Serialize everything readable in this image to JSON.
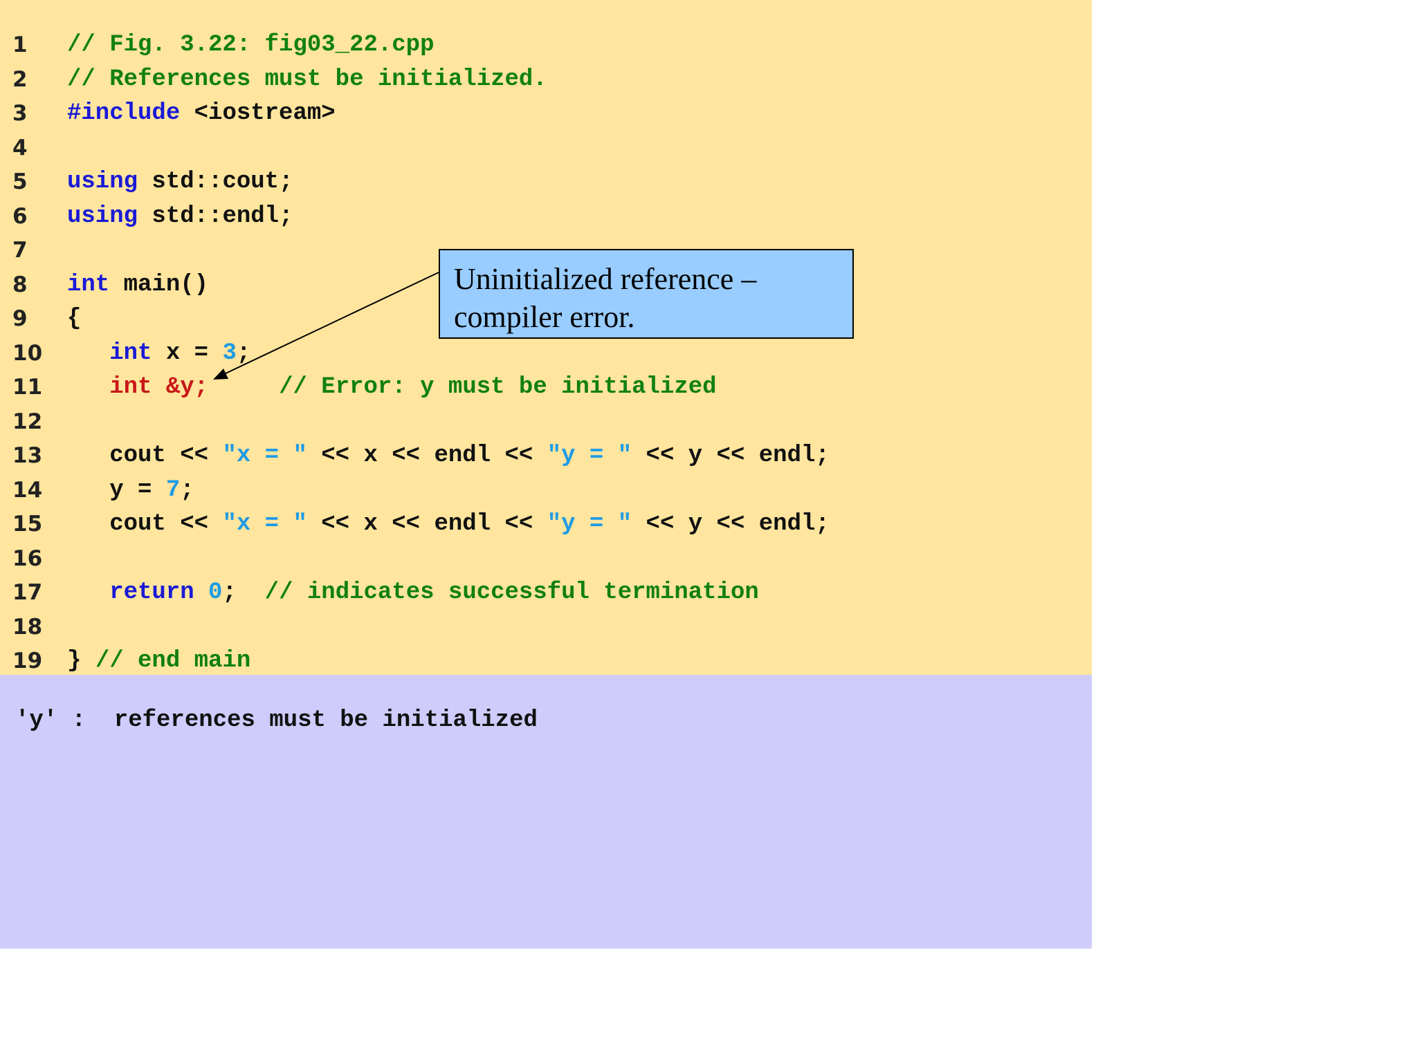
{
  "code": {
    "lines": [
      {
        "num": "1",
        "segments": [
          {
            "t": "// Fig. 3.22: fig03_22.cpp",
            "c": "cm"
          }
        ]
      },
      {
        "num": "2",
        "segments": [
          {
            "t": "// References must be initialized.",
            "c": "cm"
          }
        ]
      },
      {
        "num": "3",
        "segments": [
          {
            "t": "#include",
            "c": "kw"
          },
          {
            "t": " <iostream>",
            "c": ""
          }
        ]
      },
      {
        "num": "4",
        "segments": []
      },
      {
        "num": "5",
        "segments": [
          {
            "t": "using",
            "c": "kw"
          },
          {
            "t": " std::cout;",
            "c": ""
          }
        ]
      },
      {
        "num": "6",
        "segments": [
          {
            "t": "using",
            "c": "kw"
          },
          {
            "t": " std::endl;",
            "c": ""
          }
        ]
      },
      {
        "num": "7",
        "segments": []
      },
      {
        "num": "8",
        "segments": [
          {
            "t": "int",
            "c": "kw"
          },
          {
            "t": " main()",
            "c": ""
          }
        ]
      },
      {
        "num": "9",
        "segments": [
          {
            "t": "{",
            "c": ""
          }
        ]
      },
      {
        "num": "10",
        "segments": [
          {
            "t": "   ",
            "c": ""
          },
          {
            "t": "int",
            "c": "kw"
          },
          {
            "t": " x = ",
            "c": ""
          },
          {
            "t": "3",
            "c": "num"
          },
          {
            "t": ";",
            "c": ""
          }
        ]
      },
      {
        "num": "11",
        "segments": [
          {
            "t": "   ",
            "c": ""
          },
          {
            "t": "int &y;",
            "c": "err"
          },
          {
            "t": "     ",
            "c": ""
          },
          {
            "t": "// Error: y must be initialized",
            "c": "cm"
          }
        ]
      },
      {
        "num": "12",
        "segments": []
      },
      {
        "num": "13",
        "segments": [
          {
            "t": "   cout << ",
            "c": ""
          },
          {
            "t": "\"x = \"",
            "c": "str"
          },
          {
            "t": " << x << endl << ",
            "c": ""
          },
          {
            "t": "\"y = \"",
            "c": "str"
          },
          {
            "t": " << y << endl;",
            "c": ""
          }
        ]
      },
      {
        "num": "14",
        "segments": [
          {
            "t": "   y = ",
            "c": ""
          },
          {
            "t": "7",
            "c": "num"
          },
          {
            "t": ";",
            "c": ""
          }
        ]
      },
      {
        "num": "15",
        "segments": [
          {
            "t": "   cout << ",
            "c": ""
          },
          {
            "t": "\"x = \"",
            "c": "str"
          },
          {
            "t": " << x << endl << ",
            "c": ""
          },
          {
            "t": "\"y = \"",
            "c": "str"
          },
          {
            "t": " << y << endl;",
            "c": ""
          }
        ]
      },
      {
        "num": "16",
        "segments": []
      },
      {
        "num": "17",
        "segments": [
          {
            "t": "   ",
            "c": ""
          },
          {
            "t": "return",
            "c": "kw"
          },
          {
            "t": " ",
            "c": ""
          },
          {
            "t": "0",
            "c": "num"
          },
          {
            "t": ";  ",
            "c": ""
          },
          {
            "t": "// indicates successful termination",
            "c": "cm"
          }
        ]
      },
      {
        "num": "18",
        "segments": []
      },
      {
        "num": "19",
        "segments": [
          {
            "t": "} ",
            "c": ""
          },
          {
            "t": "// end main",
            "c": "cm"
          }
        ]
      }
    ]
  },
  "output": {
    "text": "'y' :  references must be initialized"
  },
  "callout": {
    "line1": "Uninitialized reference –",
    "line2": "compiler error."
  },
  "colors": {
    "code_background": "#ffe59e",
    "output_background": "#cfccfc",
    "callout_background": "#99ccff",
    "keyword": "#1a1ad6",
    "comment": "#118011",
    "literal": "#1e9be6",
    "error": "#c81818"
  }
}
